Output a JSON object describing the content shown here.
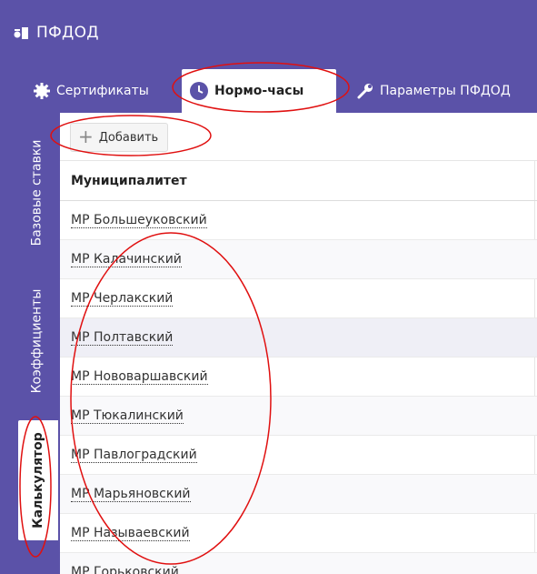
{
  "app": {
    "title": "ПФДОД"
  },
  "tabs": [
    {
      "label": "Сертификаты",
      "icon": "gear-icon"
    },
    {
      "label": "Нормо-часы",
      "icon": "clock-icon",
      "active": true
    },
    {
      "label": "Параметры ПФДОД",
      "icon": "wrench-icon"
    }
  ],
  "sidebar": [
    {
      "label": "Базовые ставки"
    },
    {
      "label": "Коэффициенты"
    },
    {
      "label": "Калькулятор",
      "active": true
    }
  ],
  "toolbar": {
    "add_label": "Добавить"
  },
  "table": {
    "header": "Муниципалитет",
    "rows": [
      "МР Большеуковский",
      "МР Калачинский",
      "МР Черлакский",
      "МР Полтавский",
      "МР Нововаршавский",
      "МР Тюкалинский",
      "МР Павлоградский",
      "МР Марьяновский",
      "МР Называевский",
      "МР Горьковский"
    ]
  },
  "colors": {
    "brand": "#5b52a8",
    "annotation": "#e01010"
  }
}
